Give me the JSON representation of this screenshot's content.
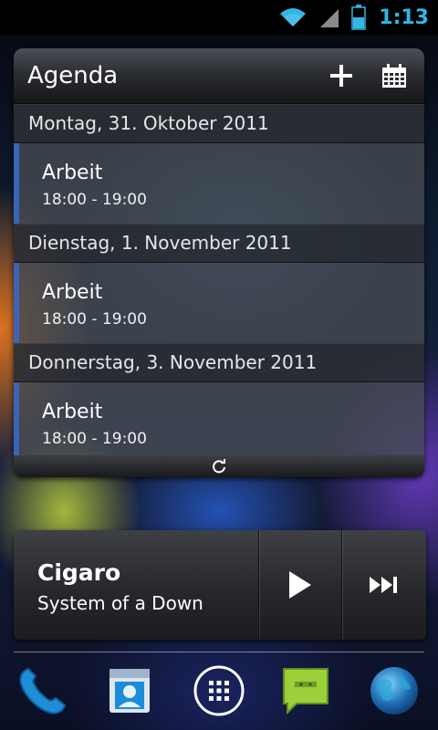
{
  "status_bar": {
    "time": "1:13",
    "icons": [
      "wifi-icon",
      "cell-signal-icon",
      "battery-icon"
    ],
    "accent_color": "#33b5e5"
  },
  "agenda": {
    "title": "Agenda",
    "header_icons": [
      "add-icon",
      "calendar-icon"
    ],
    "event_color": "#3a64b8",
    "days": [
      {
        "date": "Montag, 31. Oktober 2011",
        "events": [
          {
            "title": "Arbeit",
            "time": "18:00 - 19:00"
          }
        ]
      },
      {
        "date": "Dienstag, 1. November 2011",
        "events": [
          {
            "title": "Arbeit",
            "time": "18:00 - 19:00"
          }
        ]
      },
      {
        "date": "Donnerstag, 3. November 2011",
        "events": [
          {
            "title": "Arbeit",
            "time": "18:00 - 19:00"
          }
        ]
      }
    ],
    "footer_icon": "refresh-icon"
  },
  "music": {
    "track": "Cigaro",
    "artist": "System of a Down",
    "controls": [
      "play-icon",
      "next-track-icon"
    ]
  },
  "dock": {
    "items": [
      "phone-icon",
      "contacts-icon",
      "app-drawer-icon",
      "messaging-icon",
      "browser-icon"
    ]
  }
}
